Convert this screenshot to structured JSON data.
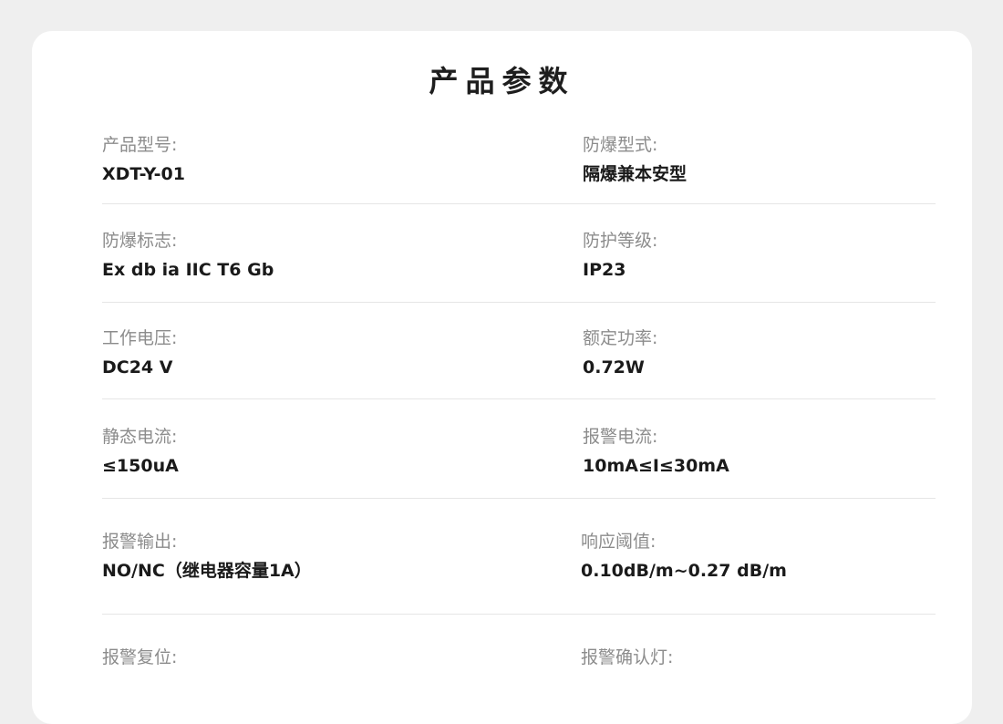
{
  "title": "产品参数",
  "params": [
    {
      "left": {
        "label": "产品型号:",
        "value": "XDT-Y-01"
      },
      "right": {
        "label": "防爆型式:",
        "value": "隔爆兼本安型"
      }
    },
    {
      "left": {
        "label": "防爆标志:",
        "value": "Ex db ia IIC T6 Gb"
      },
      "right": {
        "label": "防护等级:",
        "value": "IP23"
      }
    },
    {
      "left": {
        "label": "工作电压:",
        "value": "DC24 V"
      },
      "right": {
        "label": "额定功率:",
        "value": "0.72W"
      }
    },
    {
      "left": {
        "label": "静态电流:",
        "value": "≤150uA"
      },
      "right": {
        "label": "报警电流:",
        "value": "10mA≤I≤30mA"
      }
    },
    {
      "left": {
        "label": "报警输出:",
        "value": "NO/NC（继电器容量1A）"
      },
      "right": {
        "label": "响应阈值:",
        "value": "0.10dB/m~0.27 dB/m"
      }
    },
    {
      "left": {
        "label": "报警复位:",
        "value": ""
      },
      "right": {
        "label": "报警确认灯:",
        "value": ""
      }
    }
  ]
}
